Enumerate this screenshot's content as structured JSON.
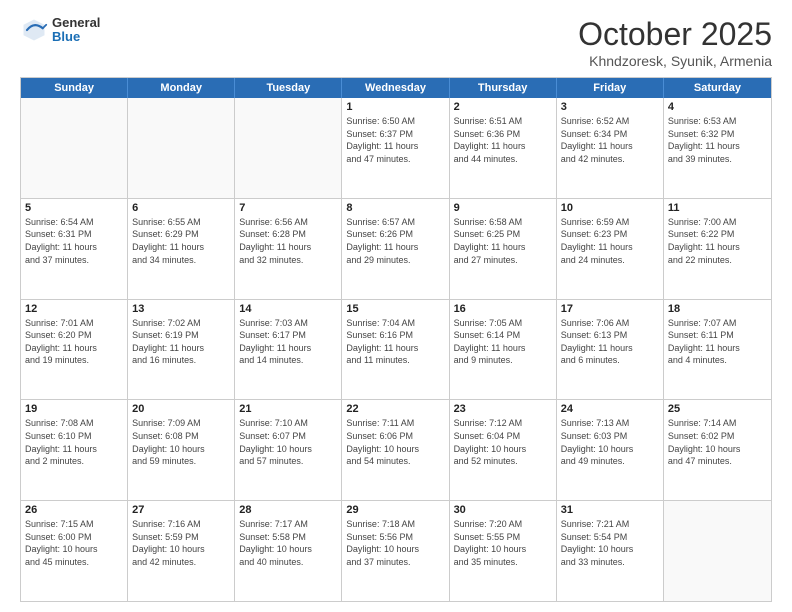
{
  "header": {
    "logo": {
      "general": "General",
      "blue": "Blue"
    },
    "title": "October 2025",
    "location": "Khndzoresk, Syunik, Armenia"
  },
  "days_of_week": [
    "Sunday",
    "Monday",
    "Tuesday",
    "Wednesday",
    "Thursday",
    "Friday",
    "Saturday"
  ],
  "weeks": [
    [
      {
        "day": "",
        "info": ""
      },
      {
        "day": "",
        "info": ""
      },
      {
        "day": "",
        "info": ""
      },
      {
        "day": "1",
        "info": "Sunrise: 6:50 AM\nSunset: 6:37 PM\nDaylight: 11 hours\nand 47 minutes."
      },
      {
        "day": "2",
        "info": "Sunrise: 6:51 AM\nSunset: 6:36 PM\nDaylight: 11 hours\nand 44 minutes."
      },
      {
        "day": "3",
        "info": "Sunrise: 6:52 AM\nSunset: 6:34 PM\nDaylight: 11 hours\nand 42 minutes."
      },
      {
        "day": "4",
        "info": "Sunrise: 6:53 AM\nSunset: 6:32 PM\nDaylight: 11 hours\nand 39 minutes."
      }
    ],
    [
      {
        "day": "5",
        "info": "Sunrise: 6:54 AM\nSunset: 6:31 PM\nDaylight: 11 hours\nand 37 minutes."
      },
      {
        "day": "6",
        "info": "Sunrise: 6:55 AM\nSunset: 6:29 PM\nDaylight: 11 hours\nand 34 minutes."
      },
      {
        "day": "7",
        "info": "Sunrise: 6:56 AM\nSunset: 6:28 PM\nDaylight: 11 hours\nand 32 minutes."
      },
      {
        "day": "8",
        "info": "Sunrise: 6:57 AM\nSunset: 6:26 PM\nDaylight: 11 hours\nand 29 minutes."
      },
      {
        "day": "9",
        "info": "Sunrise: 6:58 AM\nSunset: 6:25 PM\nDaylight: 11 hours\nand 27 minutes."
      },
      {
        "day": "10",
        "info": "Sunrise: 6:59 AM\nSunset: 6:23 PM\nDaylight: 11 hours\nand 24 minutes."
      },
      {
        "day": "11",
        "info": "Sunrise: 7:00 AM\nSunset: 6:22 PM\nDaylight: 11 hours\nand 22 minutes."
      }
    ],
    [
      {
        "day": "12",
        "info": "Sunrise: 7:01 AM\nSunset: 6:20 PM\nDaylight: 11 hours\nand 19 minutes."
      },
      {
        "day": "13",
        "info": "Sunrise: 7:02 AM\nSunset: 6:19 PM\nDaylight: 11 hours\nand 16 minutes."
      },
      {
        "day": "14",
        "info": "Sunrise: 7:03 AM\nSunset: 6:17 PM\nDaylight: 11 hours\nand 14 minutes."
      },
      {
        "day": "15",
        "info": "Sunrise: 7:04 AM\nSunset: 6:16 PM\nDaylight: 11 hours\nand 11 minutes."
      },
      {
        "day": "16",
        "info": "Sunrise: 7:05 AM\nSunset: 6:14 PM\nDaylight: 11 hours\nand 9 minutes."
      },
      {
        "day": "17",
        "info": "Sunrise: 7:06 AM\nSunset: 6:13 PM\nDaylight: 11 hours\nand 6 minutes."
      },
      {
        "day": "18",
        "info": "Sunrise: 7:07 AM\nSunset: 6:11 PM\nDaylight: 11 hours\nand 4 minutes."
      }
    ],
    [
      {
        "day": "19",
        "info": "Sunrise: 7:08 AM\nSunset: 6:10 PM\nDaylight: 11 hours\nand 2 minutes."
      },
      {
        "day": "20",
        "info": "Sunrise: 7:09 AM\nSunset: 6:08 PM\nDaylight: 10 hours\nand 59 minutes."
      },
      {
        "day": "21",
        "info": "Sunrise: 7:10 AM\nSunset: 6:07 PM\nDaylight: 10 hours\nand 57 minutes."
      },
      {
        "day": "22",
        "info": "Sunrise: 7:11 AM\nSunset: 6:06 PM\nDaylight: 10 hours\nand 54 minutes."
      },
      {
        "day": "23",
        "info": "Sunrise: 7:12 AM\nSunset: 6:04 PM\nDaylight: 10 hours\nand 52 minutes."
      },
      {
        "day": "24",
        "info": "Sunrise: 7:13 AM\nSunset: 6:03 PM\nDaylight: 10 hours\nand 49 minutes."
      },
      {
        "day": "25",
        "info": "Sunrise: 7:14 AM\nSunset: 6:02 PM\nDaylight: 10 hours\nand 47 minutes."
      }
    ],
    [
      {
        "day": "26",
        "info": "Sunrise: 7:15 AM\nSunset: 6:00 PM\nDaylight: 10 hours\nand 45 minutes."
      },
      {
        "day": "27",
        "info": "Sunrise: 7:16 AM\nSunset: 5:59 PM\nDaylight: 10 hours\nand 42 minutes."
      },
      {
        "day": "28",
        "info": "Sunrise: 7:17 AM\nSunset: 5:58 PM\nDaylight: 10 hours\nand 40 minutes."
      },
      {
        "day": "29",
        "info": "Sunrise: 7:18 AM\nSunset: 5:56 PM\nDaylight: 10 hours\nand 37 minutes."
      },
      {
        "day": "30",
        "info": "Sunrise: 7:20 AM\nSunset: 5:55 PM\nDaylight: 10 hours\nand 35 minutes."
      },
      {
        "day": "31",
        "info": "Sunrise: 7:21 AM\nSunset: 5:54 PM\nDaylight: 10 hours\nand 33 minutes."
      },
      {
        "day": "",
        "info": ""
      }
    ]
  ]
}
